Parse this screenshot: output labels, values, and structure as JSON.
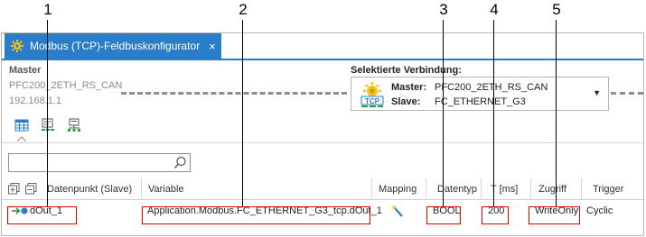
{
  "callouts": [
    "1",
    "2",
    "3",
    "4",
    "5"
  ],
  "tab": {
    "title": "Modbus (TCP)-Feldbuskonfigurator",
    "close_glyph": "×"
  },
  "master": {
    "label": "Master",
    "device": "PFC200_2ETH_RS_CAN",
    "ip": "192.168.1.1"
  },
  "selected_connection": {
    "label": "Selektierte Verbindung:",
    "master_label": "Master:",
    "master_value": "PFC200_2ETH_RS_CAN",
    "slave_label": "Slave:",
    "slave_value": "FC_ETHERNET_G3",
    "icon_badge": "TCP",
    "caret": "▼"
  },
  "search": {
    "value": "",
    "placeholder": ""
  },
  "columns": {
    "datapoint": "Datenpunkt (Slave)",
    "variable": "Variable",
    "mapping": "Mapping",
    "datatype": "Datentyp",
    "cycle": "T [ms]",
    "access": "Zugriff",
    "trigger": "Trigger"
  },
  "rows": [
    {
      "datapoint": "dOut_1",
      "variable": "Application.Modbus.FC_ETHERNET_G3_tcp.dOut_1",
      "datatype": "BOOL",
      "cycle": "200",
      "access": "WriteOnly",
      "trigger": "Cyclic"
    }
  ],
  "colors": {
    "accent": "#2a7dc8",
    "highlight": "#e00000",
    "dashed": "#8e8e8e",
    "port_green": "#2e9e3e",
    "port_blue": "#2a7dc8"
  },
  "icons": {
    "tab": "modbus-configurator-icon",
    "table_view": "table-view-icon",
    "io_view": "io-mapping-icon",
    "network_view": "network-view-icon",
    "search": "search-icon",
    "expand_all": "expand-all-icon",
    "collapse_all": "collapse-all-icon",
    "mapping": "mapping-wand-icon"
  }
}
